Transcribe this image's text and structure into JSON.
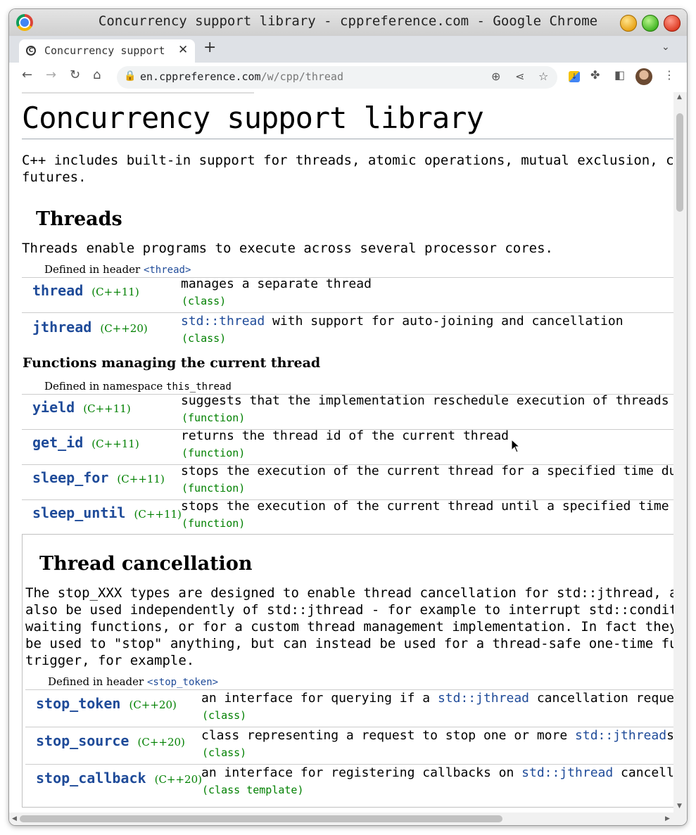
{
  "window": {
    "title": "Concurrency support library - cppreference.com - Google Chrome"
  },
  "tab": {
    "title": "Concurrency support",
    "close": "✕",
    "new": "+",
    "search": "⌄"
  },
  "toolbar": {
    "url_host": "en.cppreference.com",
    "url_path": "/w/cpp/thread"
  },
  "page": {
    "title": "Concurrency support library",
    "intro_line1": "C++ includes built-in support for threads, atomic operations, mutual exclusion, condit",
    "intro_line2": "futures.",
    "threads": {
      "heading": "Threads",
      "text": "Threads enable programs to execute across several processor cores.",
      "defined_prefix": "Defined in header ",
      "defined_header": "<thread>",
      "rows": [
        {
          "name": "thread",
          "ver": "(C++11)",
          "desc": "manages a separate thread",
          "kind": "(class)"
        },
        {
          "name": "jthread",
          "ver": "(C++20)",
          "desc_link": "std::thread",
          "desc": " with support for auto-joining and cancellation",
          "kind": "(class)"
        }
      ]
    },
    "functions": {
      "heading": "Functions managing the current thread",
      "defined_prefix": "Defined in namespace ",
      "defined_ns": "this_thread",
      "rows": [
        {
          "name": "yield",
          "ver": "(C++11)",
          "desc": "suggests that the implementation reschedule execution of threads",
          "kind": "(function)"
        },
        {
          "name": "get_id",
          "ver": "(C++11)",
          "desc": "returns the thread id of the current thread",
          "kind": "(function)"
        },
        {
          "name": "sleep_for",
          "ver": "(C++11)",
          "desc": "stops the execution of the current thread for a specified time dura",
          "kind": "(function)"
        },
        {
          "name": "sleep_until",
          "ver": "(C++11)",
          "desc": "stops the execution of the current thread until a specified time po",
          "kind": "(function)"
        }
      ]
    },
    "cancellation": {
      "heading": "Thread cancellation",
      "p1": "The stop_XXX types are designed to enable thread cancellation for std::jthread, althou",
      "p2": "also be used independently of std::jthread - for example to interrupt std::condition_v",
      "p3": "waiting functions, or for a custom thread management implementation. In fact they do no",
      "p4": "be used to \"stop\" anything, but can instead be used for a thread-safe one-time function",
      "p5": "trigger, for example.",
      "defined_prefix": "Defined in header ",
      "defined_header": "<stop_token>",
      "rows": [
        {
          "name": "stop_token",
          "ver": "(C++20)",
          "desc_pre": "an interface for querying if a ",
          "desc_link": "std::jthread",
          "desc_post": " cancellation reques",
          "kind": "(class)"
        },
        {
          "name": "stop_source",
          "ver": "(C++20)",
          "desc_pre": "class representing a request to stop one or more ",
          "desc_link": "std::jthread",
          "desc_post": "s",
          "kind": "(class)"
        },
        {
          "name": "stop_callback",
          "ver": "(C++20)",
          "desc_pre": "an interface for registering callbacks on ",
          "desc_link": "std::jthread",
          "desc_post": " cancell",
          "kind": "(class template)"
        }
      ]
    }
  }
}
